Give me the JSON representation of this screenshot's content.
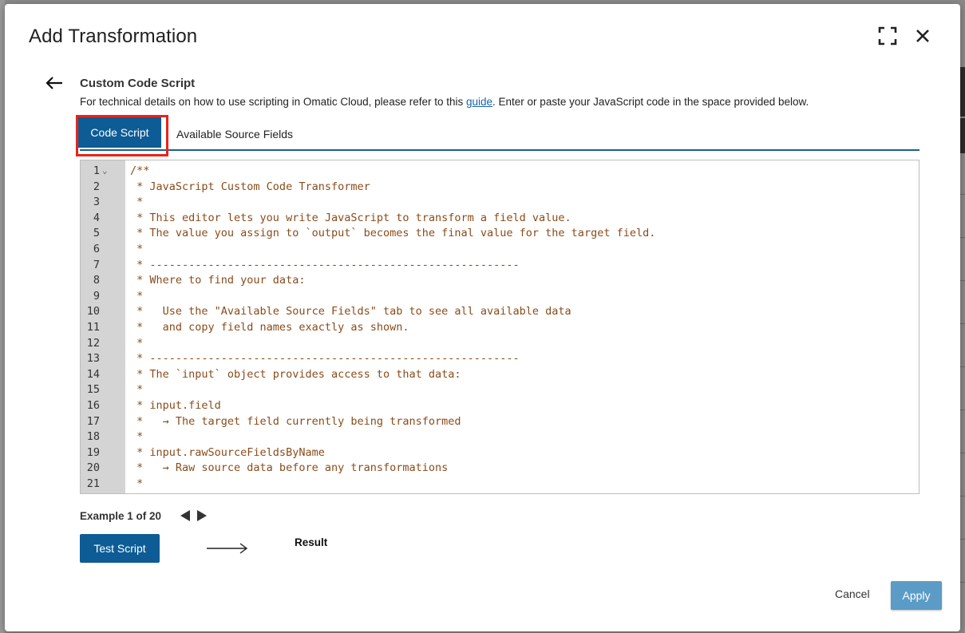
{
  "modal": {
    "title": "Add Transformation",
    "expand_icon": "expand-icon",
    "close_icon": "close-icon"
  },
  "section": {
    "title": "Custom Code Script",
    "desc_before": "For technical details on how to use scripting in Omatic Cloud, please refer to this ",
    "desc_link": "guide",
    "desc_after": ". Enter or paste your JavaScript code in the space provided below."
  },
  "tabs": [
    {
      "label": "Code Script",
      "active": true
    },
    {
      "label": "Available Source Fields",
      "active": false
    }
  ],
  "editor": {
    "lines": [
      {
        "n": "1",
        "text": "/**"
      },
      {
        "n": "2",
        "text": " * JavaScript Custom Code Transformer"
      },
      {
        "n": "3",
        "text": " *"
      },
      {
        "n": "4",
        "text": " * This editor lets you write JavaScript to transform a field value."
      },
      {
        "n": "5",
        "text": " * The value you assign to `output` becomes the final value for the target field."
      },
      {
        "n": "6",
        "text": " *"
      },
      {
        "n": "7",
        "text": " * ---------------------------------------------------------"
      },
      {
        "n": "8",
        "text": " * Where to find your data:"
      },
      {
        "n": "9",
        "text": " *"
      },
      {
        "n": "10",
        "text": " *   Use the \"Available Source Fields\" tab to see all available data"
      },
      {
        "n": "11",
        "text": " *   and copy field names exactly as shown."
      },
      {
        "n": "12",
        "text": " *"
      },
      {
        "n": "13",
        "text": " * ---------------------------------------------------------"
      },
      {
        "n": "14",
        "text": " * The `input` object provides access to that data:"
      },
      {
        "n": "15",
        "text": " *"
      },
      {
        "n": "16",
        "text": " * input.field"
      },
      {
        "n": "17",
        "text": " *   → The target field currently being transformed"
      },
      {
        "n": "18",
        "text": " *"
      },
      {
        "n": "19",
        "text": " * input.rawSourceFieldsByName"
      },
      {
        "n": "20",
        "text": " *   → Raw source data before any transformations"
      },
      {
        "n": "21",
        "text": " *"
      }
    ],
    "fold_marker": "⌄"
  },
  "example": {
    "label": "Example 1 of 20"
  },
  "actions": {
    "test_label": "Test Script",
    "result_label": "Result",
    "cancel_label": "Cancel",
    "apply_label": "Apply"
  },
  "colors": {
    "primary": "#0d5c96",
    "apply_disabled": "#5b9cc7",
    "code_comment": "#8a4b1a",
    "highlight_box": "#e8241a"
  }
}
